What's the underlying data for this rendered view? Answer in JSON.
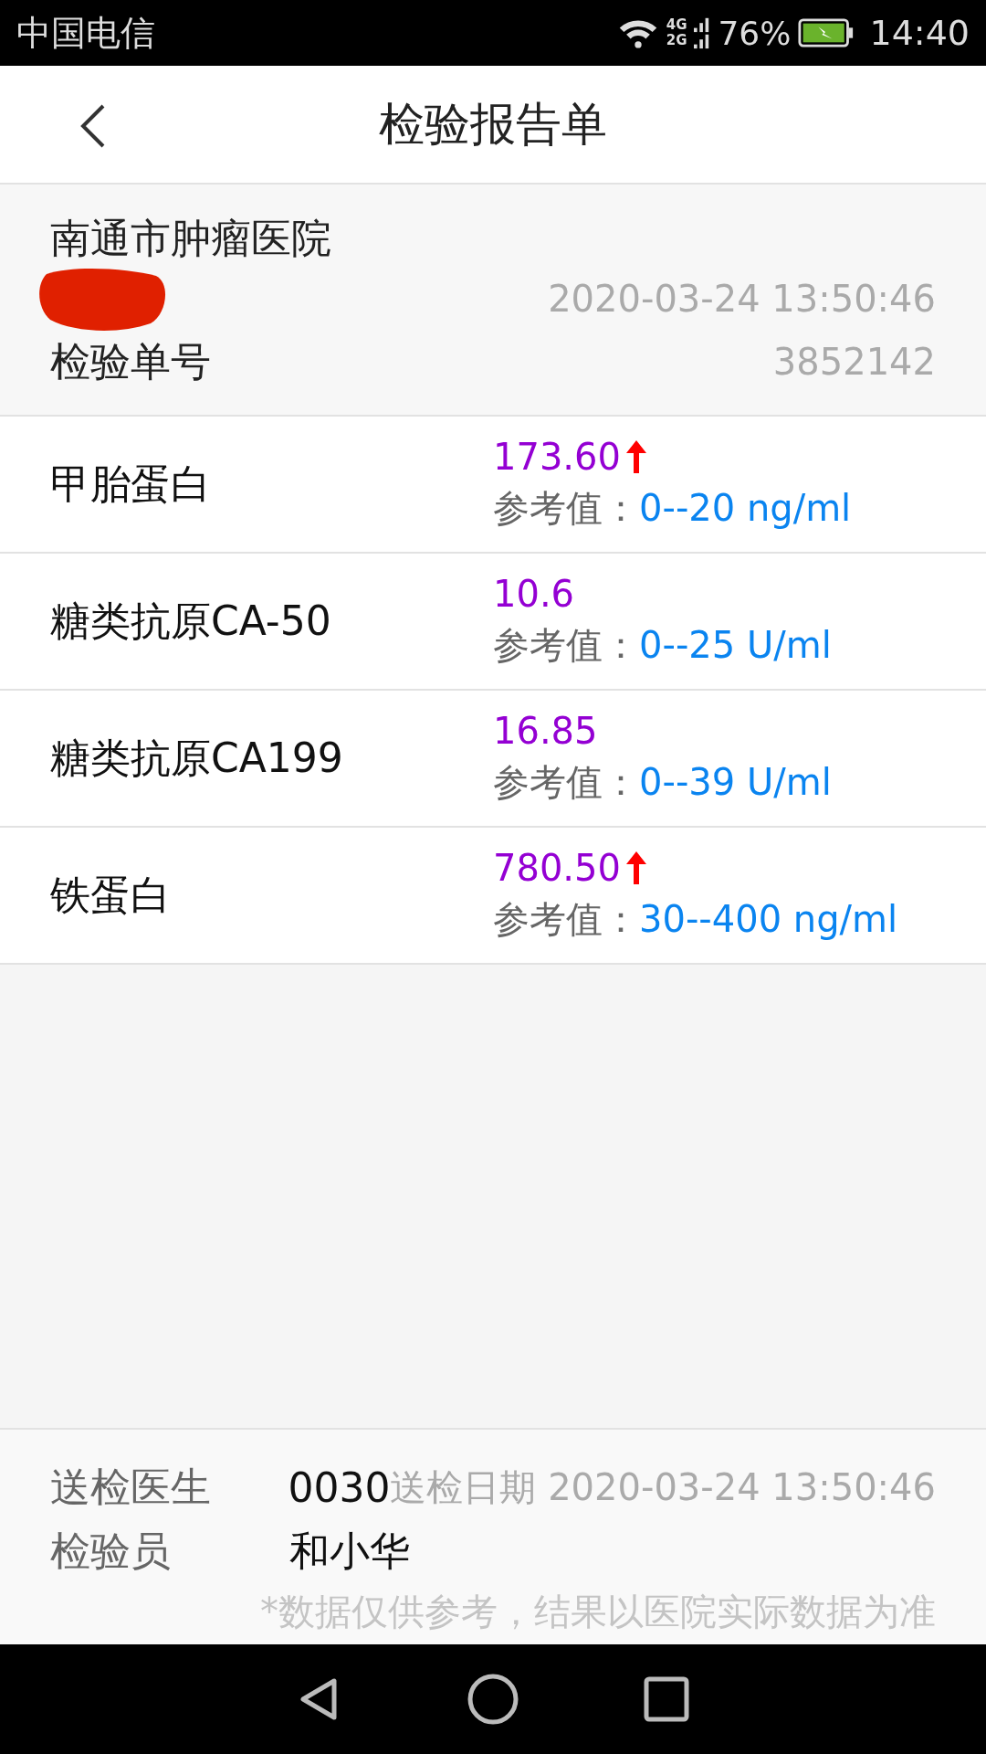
{
  "status_bar": {
    "carrier": "中国电信",
    "network_top": "4G",
    "network_bottom": "2G",
    "battery": "76%",
    "time": "14:40"
  },
  "header": {
    "title": "检验报告单"
  },
  "info": {
    "hospital": "南通市肿瘤医院",
    "datetime": "2020-03-24 13:50:46",
    "report_no_label": "检验单号",
    "report_no": "3852142"
  },
  "results": [
    {
      "name": "甲胎蛋白",
      "value": "173.60",
      "high": true,
      "ref_label": "参考值：",
      "ref_range": "0--20 ng/ml"
    },
    {
      "name": "糖类抗原CA-50",
      "value": "10.6",
      "high": false,
      "ref_label": "参考值：",
      "ref_range": "0--25 U/ml"
    },
    {
      "name": "糖类抗原CA199",
      "value": "16.85",
      "high": false,
      "ref_label": "参考值：",
      "ref_range": "0--39 U/ml"
    },
    {
      "name": "铁蛋白",
      "value": "780.50",
      "high": true,
      "ref_label": "参考值：",
      "ref_range": "30--400 ng/ml"
    }
  ],
  "footer": {
    "doctor_label": "送检医生",
    "doctor": "0030",
    "send_date_label": "送检日期",
    "send_date": "2020-03-24 13:50:46",
    "examiner_label": "检验员",
    "examiner": "和小华",
    "disclaimer": "*数据仅供参考，结果以医院实际数据为准"
  }
}
